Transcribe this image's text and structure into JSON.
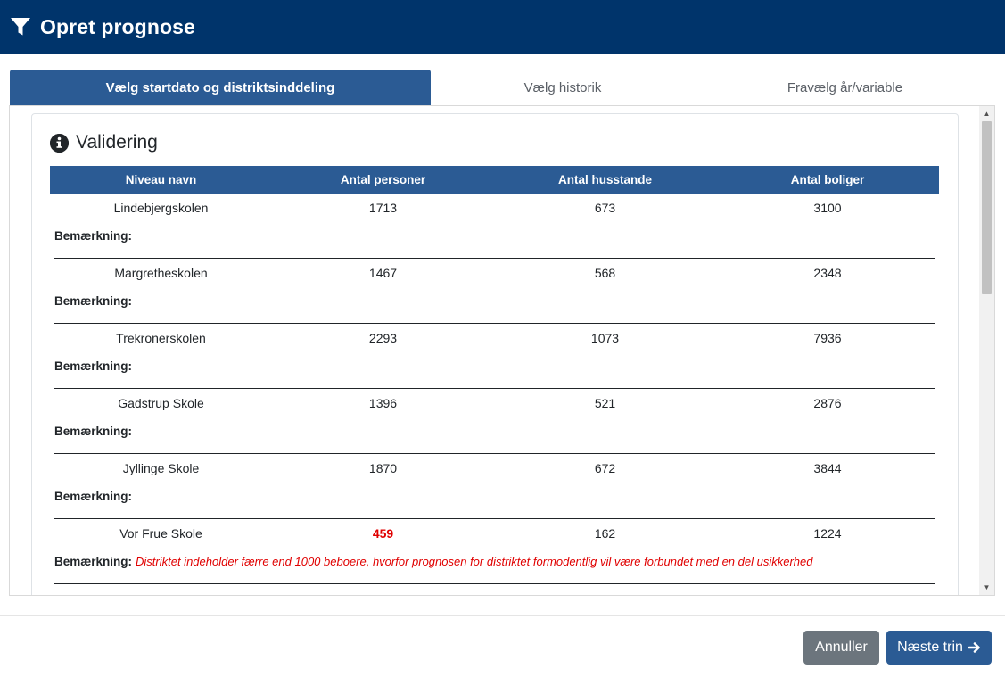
{
  "header": {
    "title": "Opret prognose",
    "icon": "filter-icon"
  },
  "tabs": [
    {
      "label": "Vælg startdato og distriktsinddeling",
      "active": true
    },
    {
      "label": "Vælg historik",
      "active": false
    },
    {
      "label": "Fravælg år/variable",
      "active": false
    }
  ],
  "validation": {
    "title": "Validering",
    "icon": "info-circle-icon",
    "columns": [
      "Niveau navn",
      "Antal personer",
      "Antal husstande",
      "Antal boliger"
    ],
    "remark_label": "Bemærkning:",
    "rows": [
      {
        "name": "Lindebjergskolen",
        "persons": "1713",
        "households": "673",
        "dwellings": "3100",
        "note": ""
      },
      {
        "name": "Margretheskolen",
        "persons": "1467",
        "households": "568",
        "dwellings": "2348",
        "note": ""
      },
      {
        "name": "Trekronerskolen",
        "persons": "2293",
        "households": "1073",
        "dwellings": "7936",
        "note": ""
      },
      {
        "name": "Gadstrup Skole",
        "persons": "1396",
        "households": "521",
        "dwellings": "2876",
        "note": ""
      },
      {
        "name": "Jyllinge Skole",
        "persons": "1870",
        "households": "672",
        "dwellings": "3844",
        "note": ""
      },
      {
        "name": "Vor Frue Skole",
        "persons": "459",
        "households": "162",
        "dwellings": "1224",
        "note": "Distriktet indeholder færre end 1000 beboere, hvorfor prognosen for distriktet formodentlig vil være forbundet med en del usikkerhed"
      }
    ]
  },
  "footer": {
    "cancel_label": "Annuller",
    "next_label": "Næste trin"
  },
  "colors": {
    "header_bg": "#00346b",
    "accent": "#2b5b94",
    "warning": "#e00000",
    "cancel_bg": "#6c757d"
  }
}
